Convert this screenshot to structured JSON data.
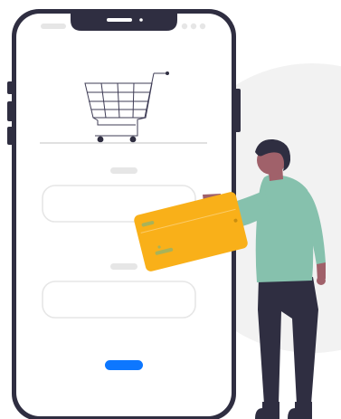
{
  "colors": {
    "background": "#ffffff",
    "backdrop_blob": "#f2f2f2",
    "phone_frame": "#2f2e41",
    "phone_screen": "#ffffff",
    "placeholder_gray": "#e6e6e6",
    "input_border": "#e6e6e6",
    "accent_button": "#0d77ff",
    "card": "#f9b019",
    "card_chip": "#a8b35a",
    "shirt": "#86c1ad",
    "pants": "#2f2e41",
    "skin": "#a0616a",
    "hair": "#2f2e41"
  },
  "icons": {
    "cart": "shopping-cart-icon",
    "card": "credit-card-icon"
  }
}
